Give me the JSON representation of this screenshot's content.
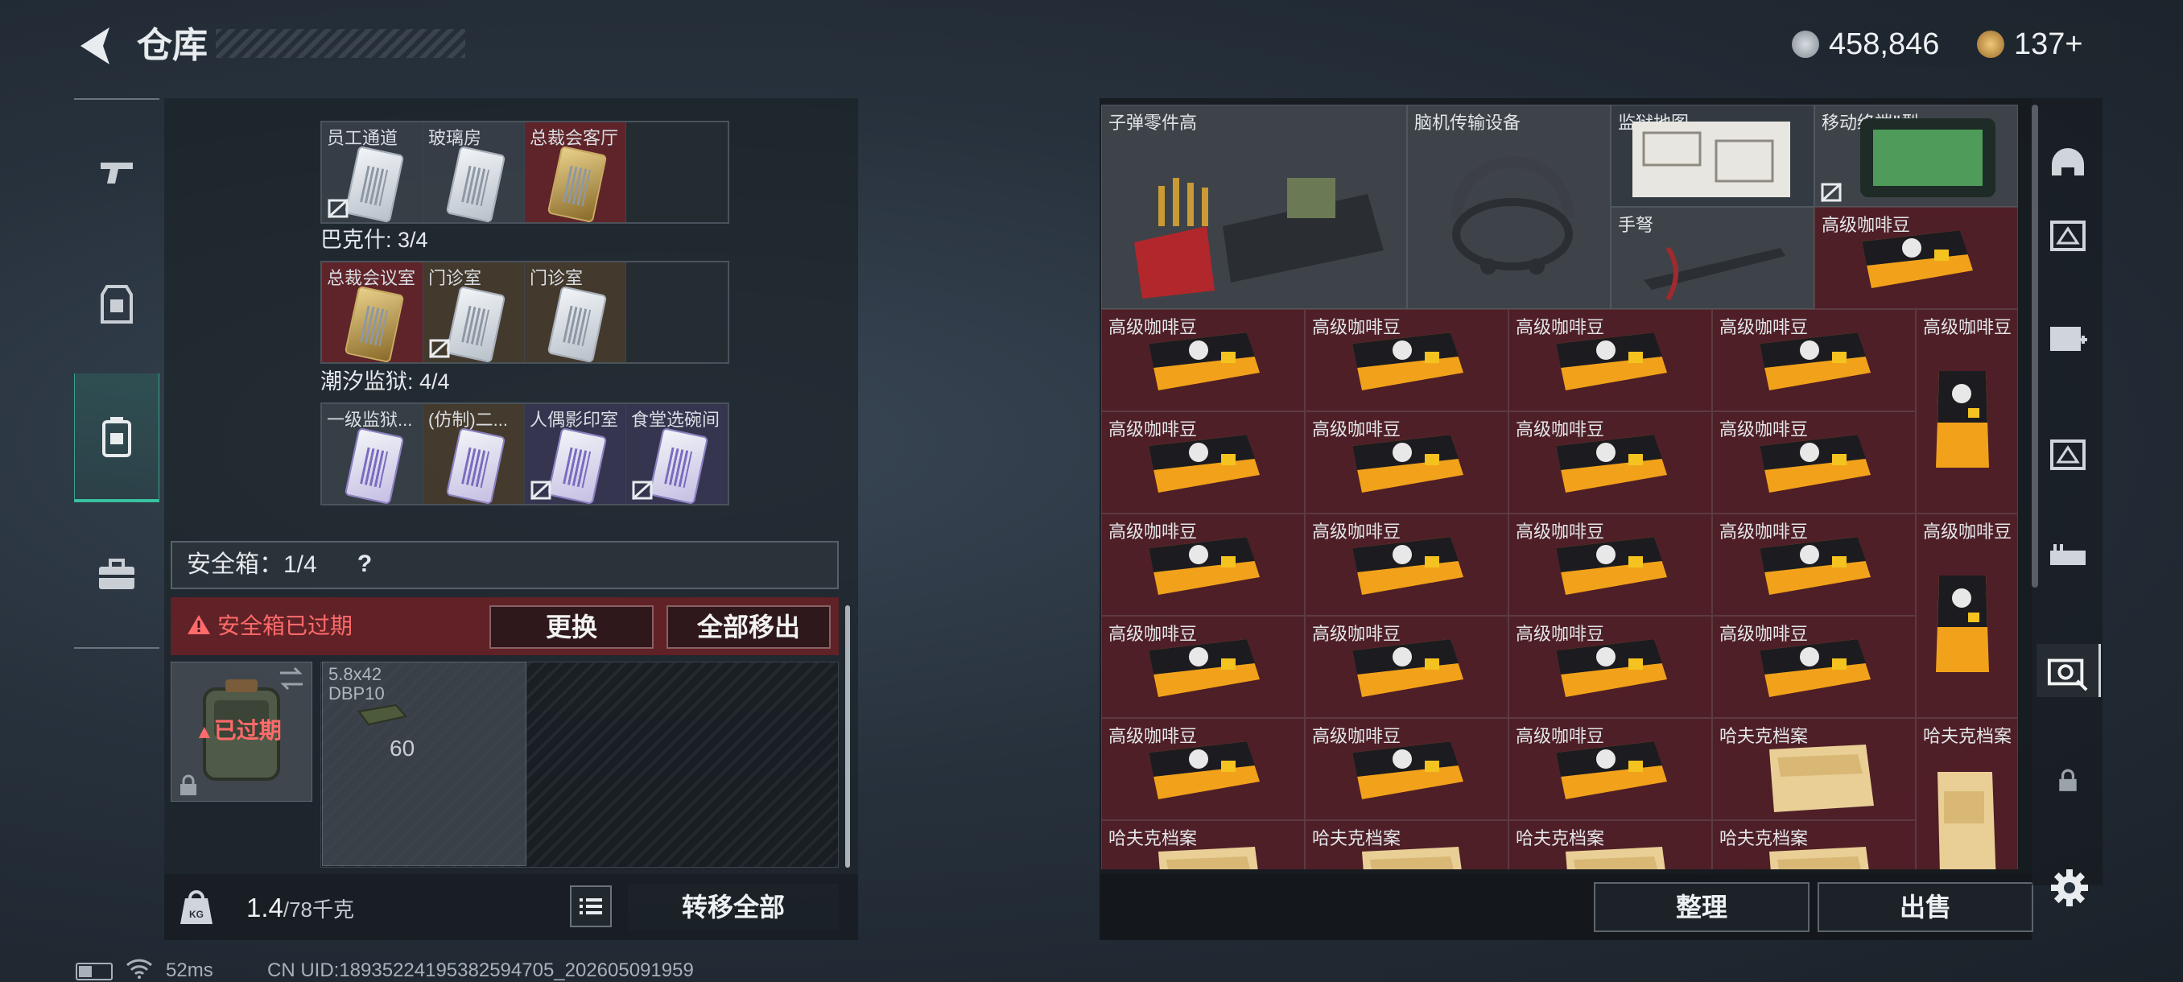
{
  "header": {
    "title": "仓库"
  },
  "currency": {
    "coins": "458,846",
    "tokens": "137+"
  },
  "left_tabs": [
    {
      "name": "weapons"
    },
    {
      "name": "equipment"
    },
    {
      "name": "keycards",
      "selected": true
    },
    {
      "name": "supplies"
    }
  ],
  "keycard_groups": [
    {
      "title": "",
      "items": [
        {
          "label": "员工通道",
          "style": "gry",
          "card": "white",
          "unlinked": true
        },
        {
          "label": "玻璃房",
          "style": "gry",
          "card": "white",
          "unlinked": false
        },
        {
          "label": "总裁会客厅",
          "style": "red",
          "card": "gold",
          "unlinked": false
        }
      ]
    },
    {
      "title": "巴克什: 3/4",
      "items": [
        {
          "label": "总裁会议室",
          "style": "red",
          "card": "gold",
          "unlinked": false
        },
        {
          "label": "门诊室",
          "style": "brn",
          "card": "white",
          "unlinked": true
        },
        {
          "label": "门诊室",
          "style": "brn",
          "card": "white",
          "unlinked": false
        }
      ]
    },
    {
      "title": "潮汐监狱: 4/4",
      "items": [
        {
          "label": "一级监狱...",
          "style": "gry",
          "card": "purple",
          "unlinked": false
        },
        {
          "label": "(仿制)二...",
          "style": "brn",
          "card": "purple",
          "unlinked": false
        },
        {
          "label": "人偶影印室",
          "style": "pur",
          "card": "purple",
          "unlinked": true
        },
        {
          "label": "食堂选碗间",
          "style": "pur",
          "card": "purple",
          "unlinked": true
        }
      ]
    }
  ],
  "safebox": {
    "label": "安全箱：1/4",
    "help": "?",
    "alert": "安全箱已过期",
    "replace_button": "更换",
    "move_all_button": "全部移出",
    "expired_tag": "已过期",
    "ammo": {
      "label": "5.8x42\nDBP10",
      "count": "60"
    }
  },
  "weight": {
    "current": "1.4",
    "max": "/78千克"
  },
  "transfer_all_button": "转移全部",
  "inventory": {
    "cells": [
      {
        "label": "子弹零件高",
        "kind": "ammo-parts"
      },
      {
        "label": "脑机传输设备",
        "kind": "headset"
      },
      {
        "label": "监狱地图",
        "kind": "map"
      },
      {
        "label": "移动终端Ⅱ型",
        "kind": "terminal"
      },
      {
        "label": "手弩",
        "kind": "crossbow"
      },
      {
        "label": "高级咖啡豆",
        "kind": "coffee"
      },
      {
        "label": "高级咖啡豆",
        "kind": "coffee"
      },
      {
        "label": "高级咖啡豆",
        "kind": "coffee"
      },
      {
        "label": "高级咖啡豆",
        "kind": "coffee"
      },
      {
        "label": "高级咖啡豆",
        "kind": "coffee"
      },
      {
        "label": "高级咖啡豆",
        "kind": "coffee-bag"
      },
      {
        "label": "高级咖啡豆",
        "kind": "coffee"
      },
      {
        "label": "高级咖啡豆",
        "kind": "coffee"
      },
      {
        "label": "高级咖啡豆",
        "kind": "coffee"
      },
      {
        "label": "高级咖啡豆",
        "kind": "coffee"
      },
      {
        "label": "高级咖啡豆",
        "kind": "coffee"
      },
      {
        "label": "高级咖啡豆",
        "kind": "coffee"
      },
      {
        "label": "高级咖啡豆",
        "kind": "coffee"
      },
      {
        "label": "高级咖啡豆",
        "kind": "coffee"
      },
      {
        "label": "高级咖啡豆",
        "kind": "coffee-bag"
      },
      {
        "label": "高级咖啡豆",
        "kind": "coffee"
      },
      {
        "label": "高级咖啡豆",
        "kind": "coffee"
      },
      {
        "label": "高级咖啡豆",
        "kind": "coffee"
      },
      {
        "label": "高级咖啡豆",
        "kind": "coffee"
      },
      {
        "label": "高级咖啡豆",
        "kind": "coffee"
      },
      {
        "label": "高级咖啡豆",
        "kind": "coffee"
      },
      {
        "label": "高级咖啡豆",
        "kind": "coffee"
      },
      {
        "label": "哈夫克档案",
        "kind": "docs"
      },
      {
        "label": "哈夫克档案",
        "kind": "docs-tall"
      },
      {
        "label": "哈夫克档案",
        "kind": "docs"
      },
      {
        "label": "哈夫克档案",
        "kind": "docs"
      },
      {
        "label": "哈夫克档案",
        "kind": "docs"
      },
      {
        "label": "哈夫克档案",
        "kind": "docs"
      }
    ]
  },
  "buttons": {
    "sort": "整理",
    "sell": "出售"
  },
  "status": {
    "ping": "52ms",
    "uid": "CN UID:18935224195382594705_202605091959"
  },
  "colors": {
    "accent": "#39c2a0",
    "alert": "#ff6a6a",
    "item_bg": "#5c2028"
  }
}
